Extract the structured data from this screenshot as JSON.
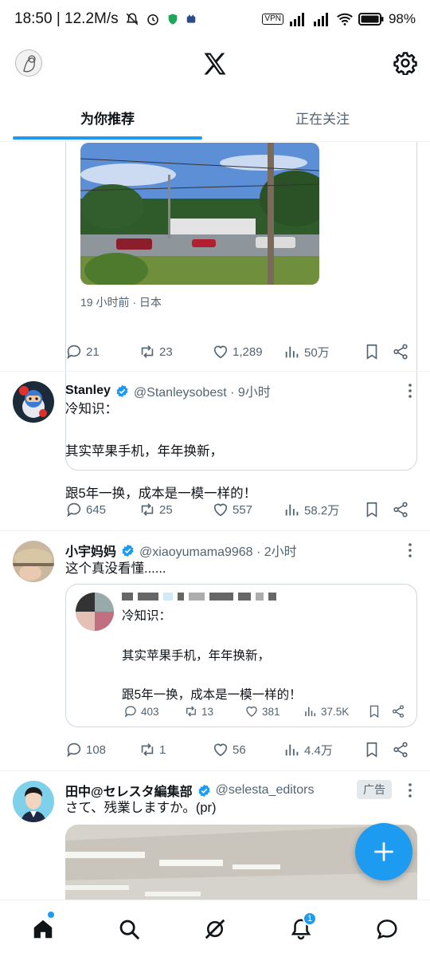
{
  "status_bar": {
    "time_speed": "18:50 | 12.2M/s",
    "vpn": "VPN",
    "battery": "98%"
  },
  "tabs": [
    {
      "label": "为你推荐",
      "active": true
    },
    {
      "label": "正在关注",
      "active": false
    }
  ],
  "tweets": [
    {
      "quote_meta": "19 小时前 · 日本",
      "actions": {
        "replies": "21",
        "retweets": "23",
        "likes": "1,289",
        "views": "50万"
      }
    },
    {
      "name": "Stanley",
      "handle": "@Stanleysobest · 9小时",
      "text": "冷知识：\n\n其实苹果手机，年年换新，\n\n跟5年一换，成本是一模一样的！",
      "actions": {
        "replies": "645",
        "retweets": "25",
        "likes": "557",
        "views": "58.2万"
      }
    },
    {
      "name": "小宇妈妈",
      "handle": "@xiaoyumama9968 · 2小时",
      "text": "这个真没看懂......",
      "quote": {
        "text": "冷知识：\n\n其实苹果手机，年年换新，\n\n跟5年一换，成本是一模一样的！",
        "actions": {
          "replies": "403",
          "retweets": "13",
          "likes": "381",
          "views": "37.5K"
        }
      },
      "actions": {
        "replies": "108",
        "retweets": "1",
        "likes": "56",
        "views": "4.4万"
      }
    },
    {
      "name": "田中@セレスタ編集部",
      "handle": "@selesta_editors",
      "ad_label": "广告",
      "text": "さて、残業しますか。(pr)"
    }
  ],
  "nav": {
    "notifications_badge": "1"
  },
  "colors": {
    "accent": "#1d9bf0",
    "text": "#0f1419",
    "secondary": "#536471"
  }
}
